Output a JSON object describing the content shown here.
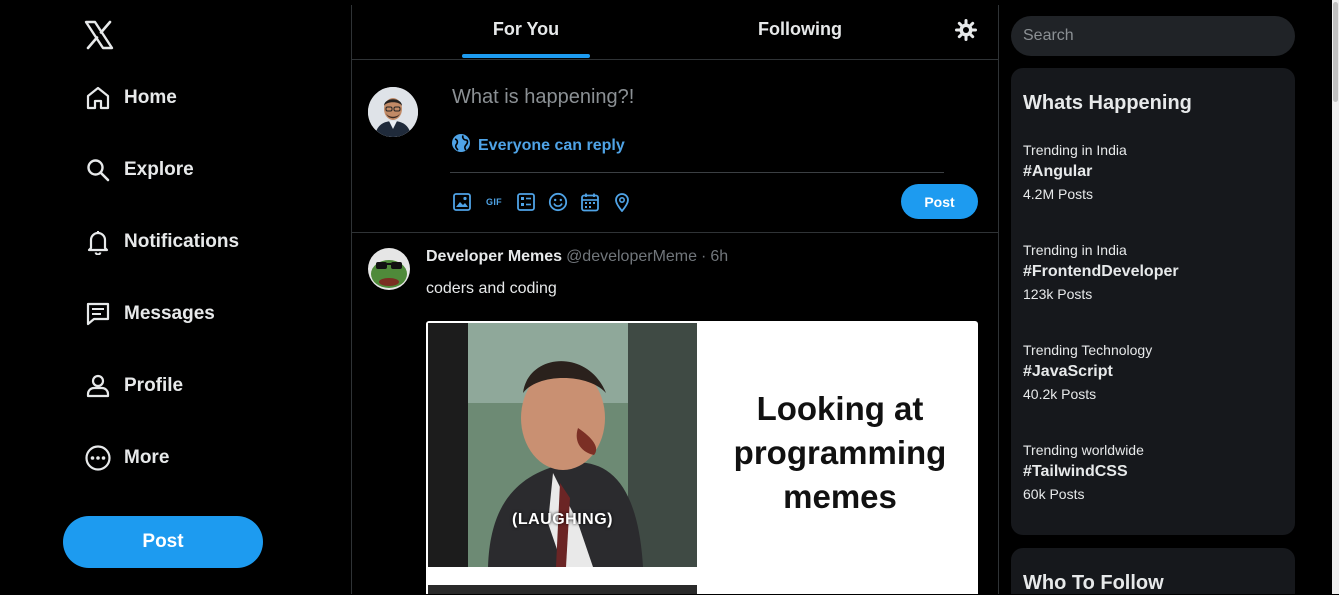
{
  "sidebar": {
    "items": [
      {
        "label": "Home",
        "icon": "home-icon"
      },
      {
        "label": "Explore",
        "icon": "search-icon"
      },
      {
        "label": "Notifications",
        "icon": "bell-icon"
      },
      {
        "label": "Messages",
        "icon": "message-icon"
      },
      {
        "label": "Profile",
        "icon": "person-icon"
      },
      {
        "label": "More",
        "icon": "more-circle-icon"
      }
    ],
    "post_label": "Post"
  },
  "header": {
    "tabs": [
      {
        "label": "For You",
        "active": true
      },
      {
        "label": "Following",
        "active": false
      }
    ]
  },
  "compose": {
    "placeholder": "What is happening?!",
    "reply_setting": "Everyone can reply",
    "tools": [
      "image-icon",
      "gif-icon",
      "poll-icon",
      "emoji-icon",
      "schedule-icon",
      "location-icon"
    ],
    "gif_text": "GIF",
    "post_label": "Post"
  },
  "tweet": {
    "name": "Developer Memes",
    "handle": "@developerMeme",
    "separator": "·",
    "time": "6h",
    "text": "coders and coding",
    "media": {
      "caption": "Looking at\nprogramming\nmemes",
      "overlay": "(LAUGHING)"
    }
  },
  "right": {
    "search_placeholder": "Search",
    "trends_title": "Whats Happening",
    "trends": [
      {
        "context": "Trending in India",
        "tag": "#Angular",
        "count": "4.2M Posts"
      },
      {
        "context": "Trending in India",
        "tag": "#FrontendDeveloper",
        "count": "123k Posts"
      },
      {
        "context": "Trending Technology",
        "tag": "#JavaScript",
        "count": "40.2k Posts"
      },
      {
        "context": "Trending worldwide",
        "tag": "#TailwindCSS",
        "count": "60k Posts"
      }
    ],
    "follow_title": "Who To Follow"
  },
  "colors": {
    "accent": "#1d9bf0",
    "background": "#000000",
    "card": "#16181c",
    "muted": "#71767b",
    "reply_link": "#4fa3e6"
  }
}
